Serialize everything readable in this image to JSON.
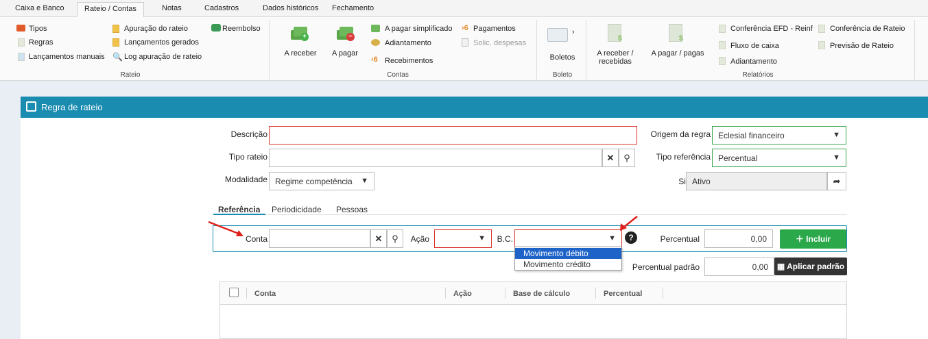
{
  "menu": {
    "tabs": [
      "Caixa e Banco",
      "Rateio / Contas",
      "Notas",
      "Cadastros",
      "Dados históricos",
      "Fechamento"
    ],
    "active": "Rateio / Contas"
  },
  "ribbon": {
    "rateio": {
      "items": [
        "Tipos",
        "Regras",
        "Lançamentos manuais",
        "Apuração do rateio",
        "Lançamentos gerados",
        "Log apuração de rateio",
        "Reembolso"
      ],
      "label": "Rateio"
    },
    "contas": {
      "a_receber": "A receber",
      "a_pagar": "A pagar",
      "items": [
        "A pagar simplificado",
        "Adiantamento",
        "Recebimentos",
        "Pagamentos",
        "Solic. despesas"
      ],
      "label": "Contas"
    },
    "boleto": {
      "boletos": "Boletos",
      "label": "Boleto"
    },
    "relatorios": {
      "a_receber_recebidas_1": "A receber /",
      "a_receber_recebidas_2": "recebidas",
      "a_pagar_pagas": "A pagar / pagas",
      "items": [
        "Conferência EFD - Reinf",
        "Fluxo de caixa",
        "Adiantamento",
        "Conferência de Rateio",
        "Previsão de Rateio"
      ],
      "label": "Relatórios"
    }
  },
  "form": {
    "title": "Regra de rateio",
    "descricao_label": "Descrição",
    "descricao_value": "",
    "tipo_rateio_label": "Tipo rateio",
    "tipo_rateio_value": "",
    "modalidade_label": "Modalidade",
    "modalidade_value": "Regime competência",
    "origem_label": "Origem da regra",
    "origem_value": "Eclesial financeiro",
    "tipo_ref_label": "Tipo referência",
    "tipo_ref_value": "Percentual",
    "situacao_label": "Situação",
    "situacao_value": "Ativo"
  },
  "tabs": [
    "Referência",
    "Periodicidade",
    "Pessoas"
  ],
  "reference": {
    "conta_label": "Conta",
    "acao_label": "Ação",
    "bc_label": "B.C.",
    "percentual_label": "Percentual",
    "percentual_value": "0,00",
    "incluir_label": "Incluir",
    "percentual_padrao_label": "Percentual padrão",
    "percentual_padrao_value": "0,00",
    "aplicar_label": "Aplicar padrão",
    "bc_options": [
      "Movimento débito",
      "Movimento crédito"
    ],
    "bc_selected": "Movimento débito"
  },
  "grid": {
    "columns": [
      "Conta",
      "Ação",
      "Base de cálculo",
      "Percentual"
    ]
  },
  "colors": {
    "header": "#1a8cb0",
    "required_border": "#d9342b",
    "valid_border": "#3aa54a",
    "include_button": "#2aa84a",
    "arrow": "#e0201a"
  }
}
